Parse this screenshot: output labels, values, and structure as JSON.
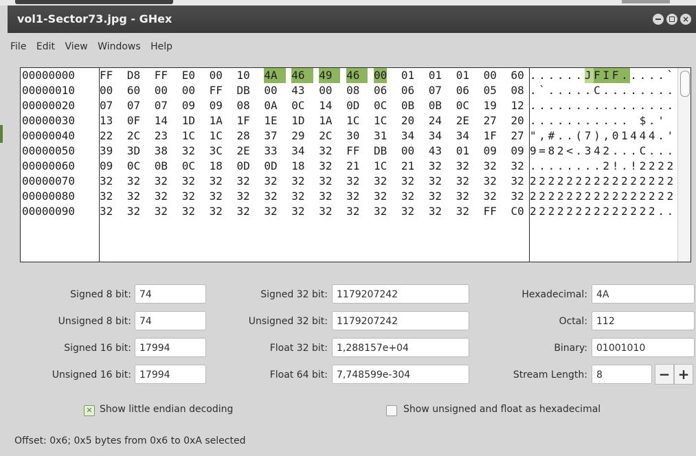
{
  "window": {
    "title": "vol1-Sector73.jpg - GHex"
  },
  "menu": [
    "File",
    "Edit",
    "View",
    "Windows",
    "Help"
  ],
  "hex": {
    "offsets": [
      "00000000",
      "00000010",
      "00000020",
      "00000030",
      "00000040",
      "00000050",
      "00000060",
      "00000070",
      "00000080",
      "00000090"
    ],
    "rows": [
      [
        "FF",
        "D8",
        "FF",
        "E0",
        "00",
        "10",
        "4A",
        "46",
        "49",
        "46",
        "00",
        "01",
        "01",
        "01",
        "00",
        "60"
      ],
      [
        "00",
        "60",
        "00",
        "00",
        "FF",
        "DB",
        "00",
        "43",
        "00",
        "08",
        "06",
        "06",
        "07",
        "06",
        "05",
        "08"
      ],
      [
        "07",
        "07",
        "07",
        "09",
        "09",
        "08",
        "0A",
        "0C",
        "14",
        "0D",
        "0C",
        "0B",
        "0B",
        "0C",
        "19",
        "12"
      ],
      [
        "13",
        "0F",
        "14",
        "1D",
        "1A",
        "1F",
        "1E",
        "1D",
        "1A",
        "1C",
        "1C",
        "20",
        "24",
        "2E",
        "27",
        "20"
      ],
      [
        "22",
        "2C",
        "23",
        "1C",
        "1C",
        "28",
        "37",
        "29",
        "2C",
        "30",
        "31",
        "34",
        "34",
        "34",
        "1F",
        "27"
      ],
      [
        "39",
        "3D",
        "38",
        "32",
        "3C",
        "2E",
        "33",
        "34",
        "32",
        "FF",
        "DB",
        "00",
        "43",
        "01",
        "09",
        "09"
      ],
      [
        "09",
        "0C",
        "0B",
        "0C",
        "18",
        "0D",
        "0D",
        "18",
        "32",
        "21",
        "1C",
        "21",
        "32",
        "32",
        "32",
        "32"
      ],
      [
        "32",
        "32",
        "32",
        "32",
        "32",
        "32",
        "32",
        "32",
        "32",
        "32",
        "32",
        "32",
        "32",
        "32",
        "32",
        "32"
      ],
      [
        "32",
        "32",
        "32",
        "32",
        "32",
        "32",
        "32",
        "32",
        "32",
        "32",
        "32",
        "32",
        "32",
        "32",
        "32",
        "32"
      ],
      [
        "32",
        "32",
        "32",
        "32",
        "32",
        "32",
        "32",
        "32",
        "32",
        "32",
        "32",
        "32",
        "32",
        "32",
        "FF",
        "C0"
      ]
    ],
    "ascii": [
      "......JFIF.....`",
      ".`.....C........",
      "................",
      "........... $.'",
      "\",#..(7),01444.'",
      "9=82<.342...C...",
      "........2!.!2222",
      "2222222222222222",
      "2222222222222222",
      "22222222222222.."
    ],
    "selection": {
      "row": 0,
      "start": 6,
      "end": 10
    }
  },
  "fields": {
    "signed8_label": "Signed 8 bit:",
    "signed8_value": "74",
    "unsigned8_label": "Unsigned 8 bit:",
    "unsigned8_value": "74",
    "signed16_label": "Signed 16 bit:",
    "signed16_value": "17994",
    "unsigned16_label": "Unsigned 16 bit:",
    "unsigned16_value": "17994",
    "signed32_label": "Signed 32 bit:",
    "signed32_value": "1179207242",
    "unsigned32_label": "Unsigned 32 bit:",
    "unsigned32_value": "1179207242",
    "float32_label": "Float 32 bit:",
    "float32_value": "1,288157e+04",
    "float64_label": "Float 64 bit:",
    "float64_value": "7,748599e-304",
    "hex_label": "Hexadecimal:",
    "hex_value": "4A",
    "octal_label": "Octal:",
    "octal_value": "112",
    "binary_label": "Binary:",
    "binary_value": "01001010",
    "stream_label": "Stream Length:",
    "stream_value": "8",
    "minus": "−",
    "plus": "+"
  },
  "options": {
    "little_endian_label": "Show little endian decoding",
    "little_endian_checked": true,
    "hex_float_label": "Show unsigned and float as hexadecimal",
    "hex_float_checked": false,
    "check_mark": "✕"
  },
  "status": "Offset: 0x6; 0x5 bytes from 0x6 to 0xA selected",
  "colors": {
    "selection": "#8db55e",
    "titlebar": "#3a3a3a"
  }
}
